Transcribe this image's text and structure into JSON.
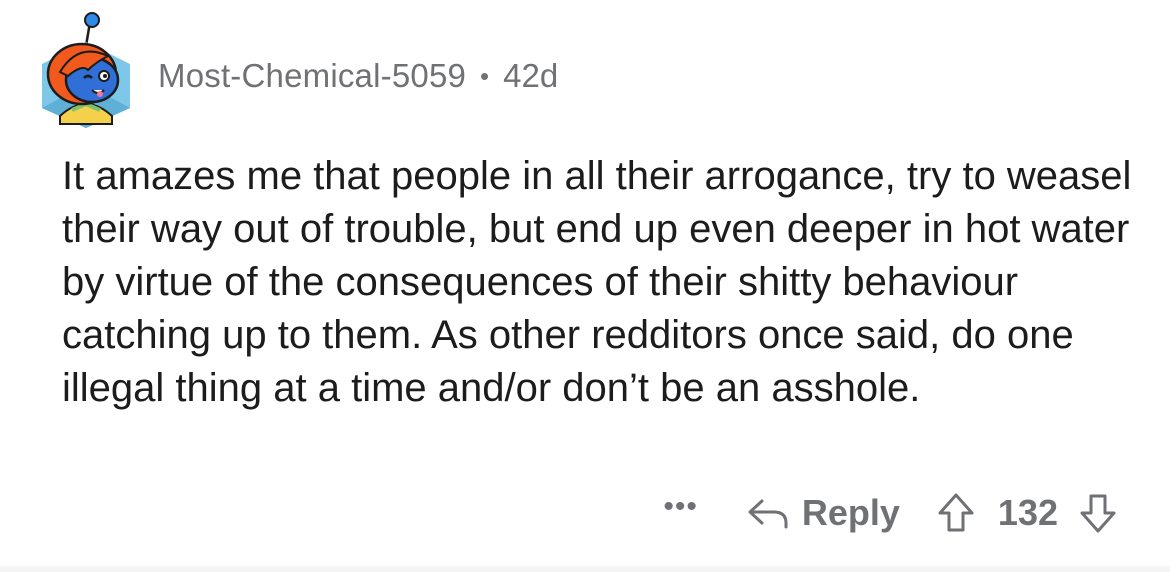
{
  "comment": {
    "username": "Most-Chemical-5059",
    "separator": "•",
    "age": "42d",
    "avatar_icon": "snoo-avatar-icon",
    "body": "It amazes me that people in all their arrogance, try to weasel their way out of trouble, but end up even deeper in hot water by virtue of the consequences of their shitty behaviour catching up to them. As other redditors once said, do one illegal thing at a time and/or don’t be an asshole."
  },
  "actions": {
    "more_label": "•••",
    "reply_label": "Reply",
    "score": "132",
    "reply_icon": "reply-arrow-icon",
    "upvote_icon": "upvote-arrow-icon",
    "downvote_icon": "downvote-arrow-icon"
  },
  "colors": {
    "text_primary": "#1c1c1c",
    "text_muted": "#6f7175",
    "avatar_hair": "#f25a1d",
    "avatar_face": "#2f6fd6",
    "avatar_bg": "#7ec7e8"
  }
}
